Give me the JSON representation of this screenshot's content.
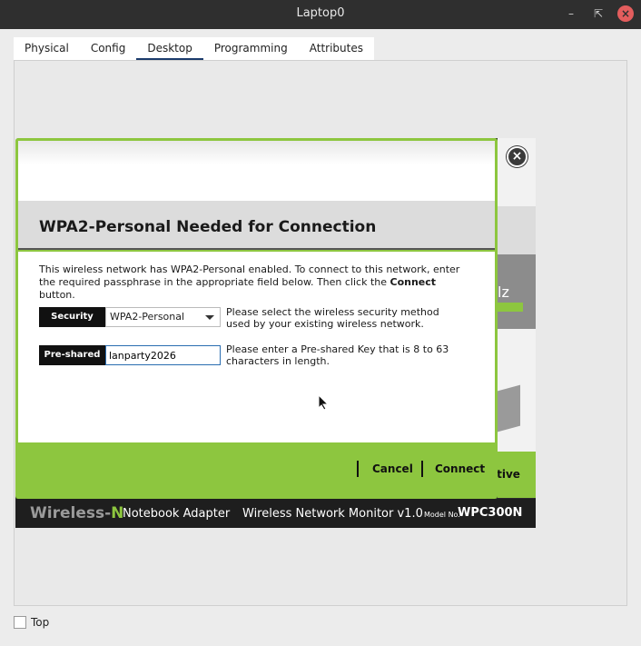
{
  "window": {
    "title": "Laptop0",
    "min_icon": "minimize-icon",
    "max_icon": "maximize-icon",
    "close_icon": "close-icon"
  },
  "tabs": [
    {
      "label": "Physical"
    },
    {
      "label": "Config"
    },
    {
      "label": "Desktop",
      "active": true
    },
    {
      "label": "Programming"
    },
    {
      "label": "Attributes"
    }
  ],
  "dialog": {
    "title": "WPA2-Personal Needed for Connection",
    "description_pre": "This wireless network has WPA2-Personal enabled. To connect to this network, enter the required passphrase in the appropriate field below. Then click the ",
    "description_bold": "Connect",
    "description_post": " button.",
    "security_label": "Security",
    "security_value": "WPA2-Personal",
    "security_hint": "Please select the wireless security method used by your existing wireless network.",
    "psk_label": "Pre-shared Key",
    "psk_value": "lanparty2026",
    "psk_hint": "Please enter a Pre-shared Key that is 8 to 63 characters in length.",
    "cancel_label": "Cancel",
    "connect_label": "Connect"
  },
  "background_app": {
    "partial_hz": "lz",
    "partial_active": "ctive"
  },
  "footer": {
    "brand": "Wireless-",
    "brand_n": "N",
    "product": "Notebook Adapter",
    "monitor": "Wireless Network Monitor  v1.0",
    "model_label": "Model No.",
    "model": "WPC300N"
  },
  "bottom": {
    "top_label": "Top"
  },
  "colors": {
    "accent_green": "#8dc63f",
    "titlebar": "#2f2f2f",
    "tab_active": "#1b3b6b"
  }
}
